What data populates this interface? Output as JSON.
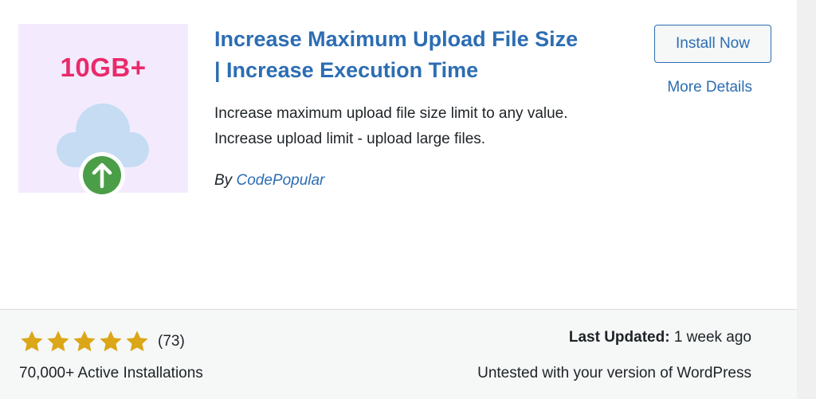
{
  "plugin": {
    "icon_text": "10GB+",
    "title": "Increase Maximum Upload File Size | Increase Execution Time",
    "description": "Increase maximum upload file size limit to any value. Increase upload limit - upload large files.",
    "author_prefix": "By",
    "author_name": "CodePopular"
  },
  "actions": {
    "install_label": "Install Now",
    "more_details_label": "More Details"
  },
  "meta": {
    "rating_stars": 5,
    "rating_count": "(73)",
    "active_installs": "70,000+ Active Installations",
    "last_updated_label": "Last Updated:",
    "last_updated_value": "1 week ago",
    "compatibility": "Untested with your version of WordPress"
  },
  "colors": {
    "link_blue": "#2c6db3",
    "icon_pink": "#e92a6b",
    "icon_bg": "#f3ebfd",
    "star_gold": "#dba617",
    "arrow_green": "#4a9e47",
    "cloud_blue": "#c5dcf3"
  }
}
